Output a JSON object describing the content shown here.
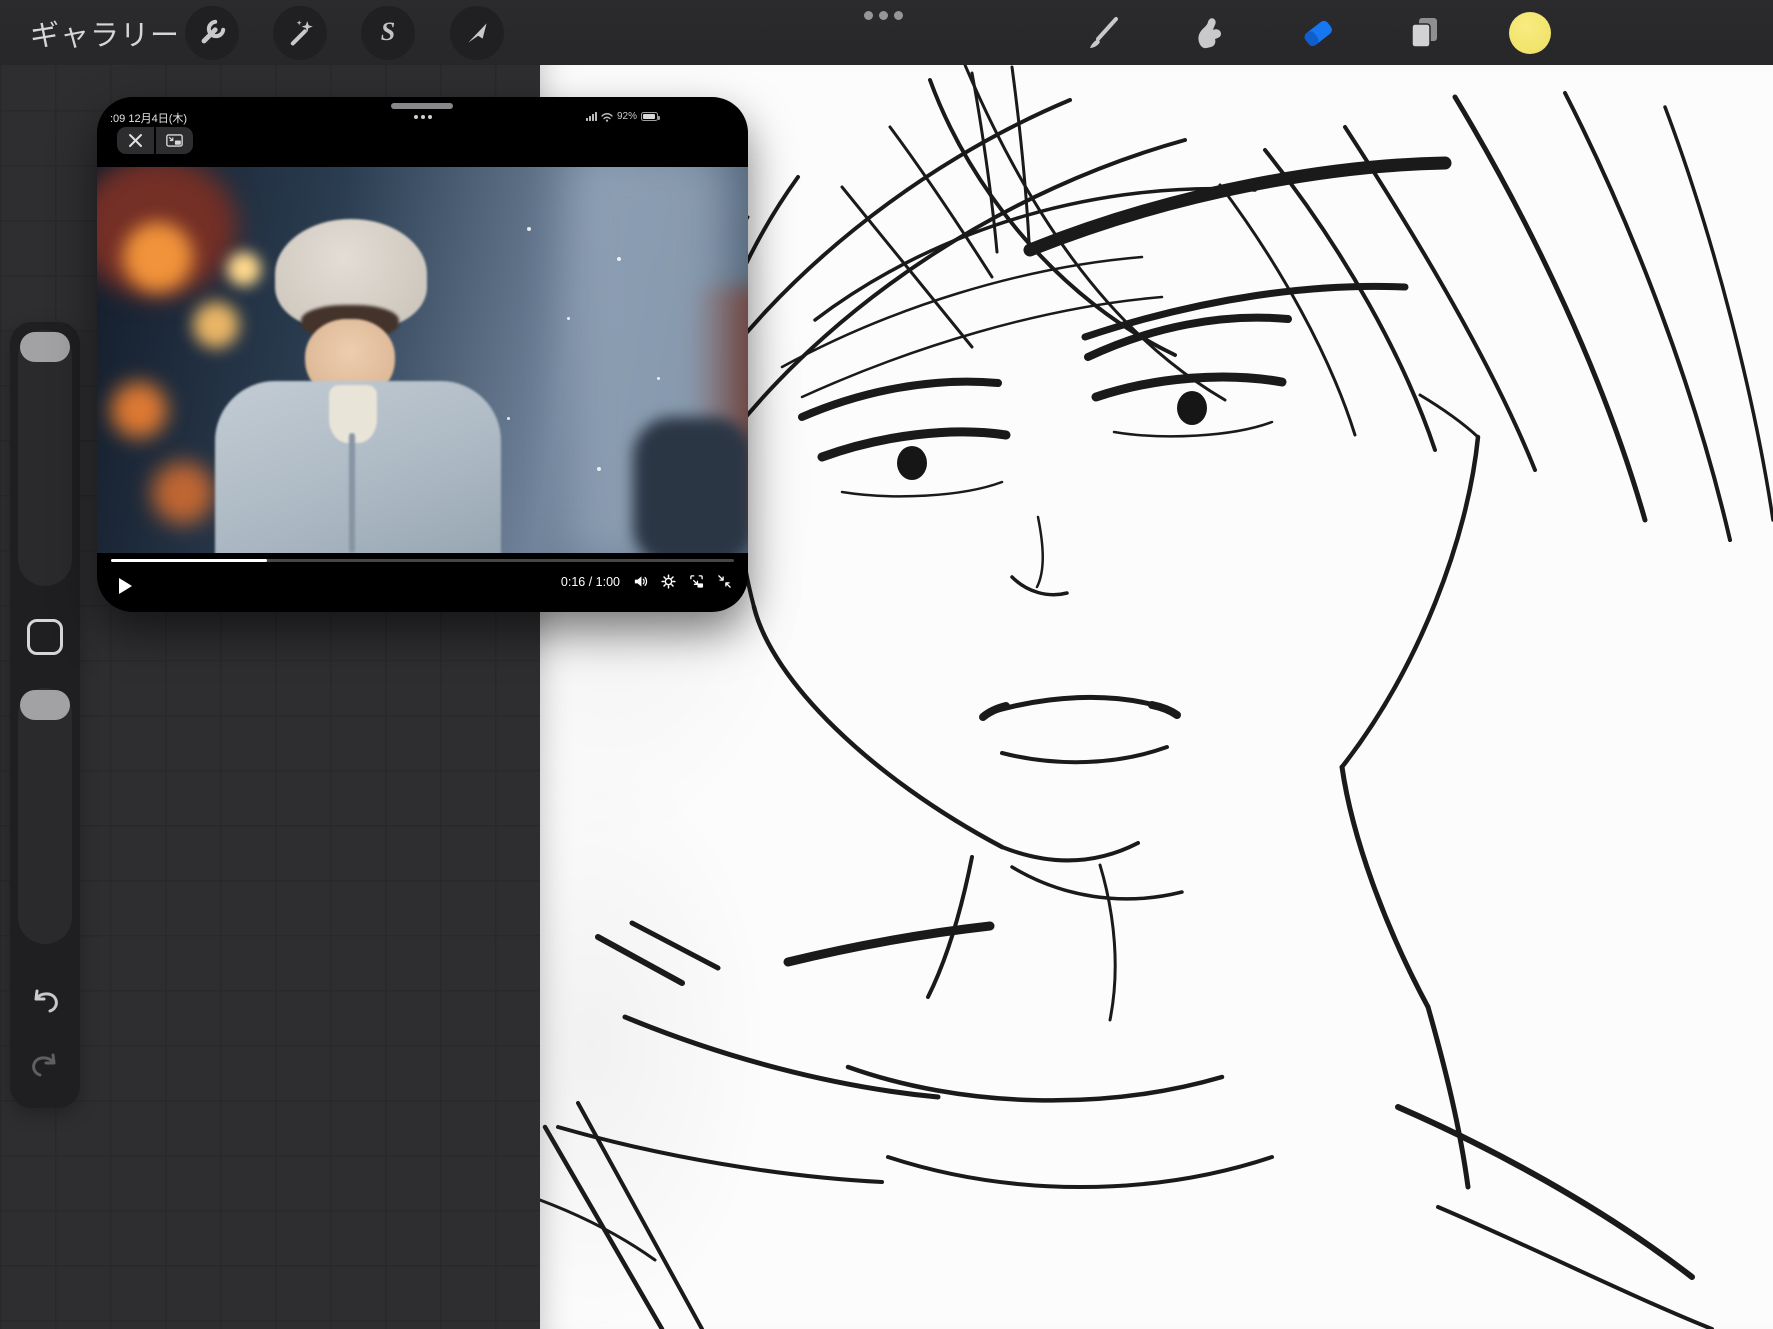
{
  "toolbar": {
    "gallery_label": "ギャラリー",
    "selection_glyph": "S",
    "left_icons": [
      "actions-wrench-icon",
      "adjustments-magic-wand-icon",
      "selection-s-icon",
      "transform-arrow-icon"
    ],
    "right_icons": [
      "brush-icon",
      "smudge-icon",
      "eraser-icon",
      "layers-icon",
      "color-swatch"
    ],
    "active_tool": "eraser",
    "eraser_color": "#1677f0",
    "swatch_color": "#f3e468",
    "swatch_style": "background:radial-gradient(circle at 42% 35%, #f8ec82, #eedf61)"
  },
  "sidebar": {
    "items": [
      "brush-size-slider",
      "modify-button",
      "brush-opacity-slider",
      "undo-button",
      "redo-button"
    ]
  },
  "pip": {
    "status": {
      "datetime": ":09  12月4日(木)",
      "battery_percent": "92%"
    },
    "buttons": [
      "close-button",
      "pip-exit-button"
    ],
    "player": {
      "time_display": "0:16 / 1:00",
      "progress_style": "width:25%",
      "icons": [
        "play-icon",
        "volume-icon",
        "settings-gear-icon",
        "pip-mode-icon",
        "fullscreen-exit-icon"
      ],
      "scene": "person wearing cream beanie and light blue puffer jacket on snowy night street with warm bokeh lights"
    }
  },
  "canvas": {
    "content": "rough black line sketch of a face with swept bangs, two eyes, parted mouth, neck and shoulders"
  },
  "colors": {
    "topbar": "#2a2a2c",
    "workspace": "#2e2e31",
    "canvas": "#fcfcfc",
    "sidebar_panel": "#1f1f21",
    "slider_handle": "#a2a2a4"
  }
}
